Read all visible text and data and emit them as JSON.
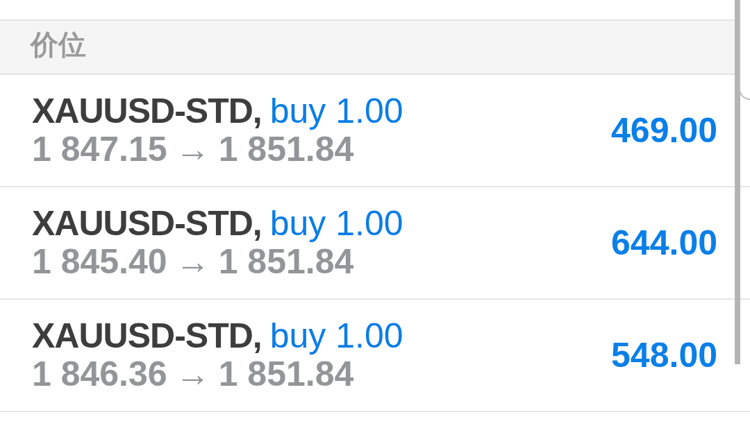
{
  "header": {
    "title": "价位"
  },
  "positions": [
    {
      "symbol": "XAUUSD-STD,",
      "order": "buy 1.00",
      "open_price": "1 847.15",
      "arrow": "→",
      "current_price": "1 851.84",
      "profit": "469.00"
    },
    {
      "symbol": "XAUUSD-STD,",
      "order": "buy 1.00",
      "open_price": "1 845.40",
      "arrow": "→",
      "current_price": "1 851.84",
      "profit": "644.00"
    },
    {
      "symbol": "XAUUSD-STD,",
      "order": "buy 1.00",
      "open_price": "1 846.36",
      "arrow": "→",
      "current_price": "1 851.84",
      "profit": "548.00"
    }
  ]
}
